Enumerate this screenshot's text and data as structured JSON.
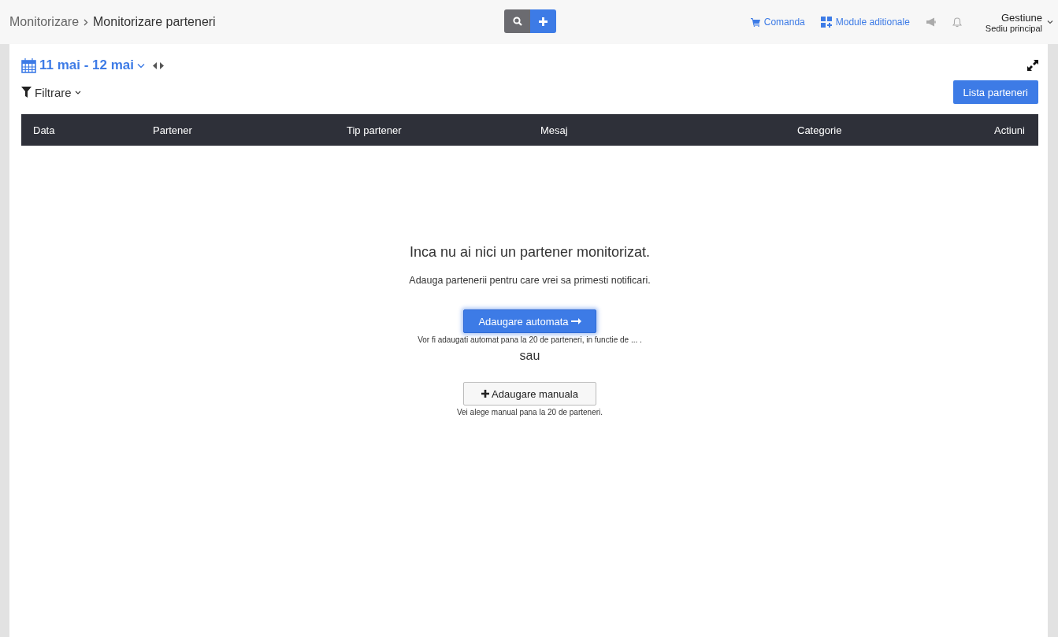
{
  "breadcrumb": {
    "parent": "Monitorizare",
    "current": "Monitorizare parteneri"
  },
  "header_links": [
    {
      "kind": "cart",
      "label": "Comanda"
    },
    {
      "kind": "modules",
      "label": "Module aditionale"
    }
  ],
  "account": {
    "title": "Gestiune",
    "subtitle": "Sediu principal"
  },
  "date_range": "11 mai - 12 mai",
  "filter": {
    "label": "Filtrare"
  },
  "list_button": "Lista parteneri",
  "table": {
    "columns": [
      "Data",
      "Partener",
      "Tip partener",
      "Mesaj",
      "Categorie",
      "Actiuni"
    ]
  },
  "empty_state": {
    "title": "Inca nu ai nici un partener monitorizat.",
    "subtitle": "Adauga partenerii pentru care vrei sa primesti notificari.",
    "options": [
      {
        "kind": "primary",
        "label": "Adaugare automata",
        "note": "Vor fi adaugati automat pana la 20 de parteneri, in functie de ... ."
      },
      {
        "kind": "separator",
        "label": "sau"
      },
      {
        "kind": "secondary",
        "label": "Adaugare manuala",
        "note": "Vei alege manual pana la 20 de parteneri."
      }
    ]
  }
}
